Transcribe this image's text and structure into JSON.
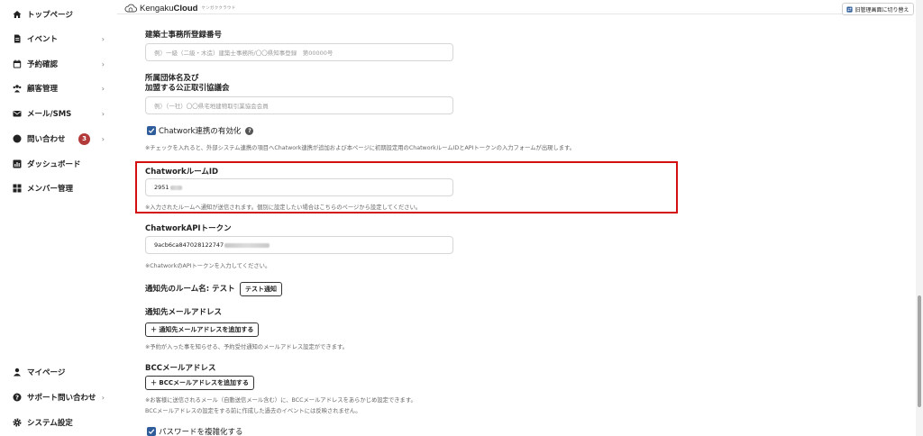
{
  "sidebar": {
    "items": [
      {
        "label": "トップページ",
        "icon": "home-icon"
      },
      {
        "label": "イベント",
        "icon": "document-icon",
        "chevron": "›"
      },
      {
        "label": "予約確認",
        "icon": "calendar-icon",
        "chevron": "›"
      },
      {
        "label": "顧客管理",
        "icon": "users-icon",
        "chevron": "›"
      },
      {
        "label": "メール/SMS",
        "icon": "mail-icon",
        "chevron": "›"
      },
      {
        "label": "問い合わせ",
        "icon": "chat-icon",
        "chevron": "›",
        "badge": "3"
      },
      {
        "label": "ダッシュボード",
        "icon": "chart-icon"
      },
      {
        "label": "メンバー管理",
        "icon": "grid-icon"
      }
    ],
    "bottom_items": [
      {
        "label": "マイページ",
        "icon": "person-icon"
      },
      {
        "label": "サポート問い合わせ",
        "icon": "help-icon",
        "chevron": "›"
      },
      {
        "label": "システム設定",
        "icon": "gear-icon"
      }
    ]
  },
  "header": {
    "logo_prefix": "Kengaku",
    "logo_bold": "Cloud",
    "logo_sub": "ケンガククラウド",
    "switch_button": "旧管理画面に切り替え"
  },
  "form": {
    "registration": {
      "label": "建築士事務所登録番号",
      "placeholder": "例）一級（二級・木造）建築士事務所/〇〇県知事登録　第00000号"
    },
    "association": {
      "label_line1": "所属団体名及び",
      "label_line2": "加盟する公正取引協議会",
      "placeholder": "例）（一社）〇〇県宅地建物取引業協会会員"
    },
    "chatwork_toggle": {
      "label": "Chatwork連携の有効化",
      "checked": true,
      "help": "※チェックを入れると、外部システム連携の項目へChatwork連携が追加および本ページに初期設定用のChatworkルームIDとAPIトークンの入力フォームが出現します。"
    },
    "room_id": {
      "label": "ChatworkルームID",
      "value": "2951",
      "help": "※入力されたルームへ通知が送信されます。個別に設定したい場合はこちらのページから設定してください。"
    },
    "api_token": {
      "label": "ChatworkAPIトークン",
      "value": "9acb6ca847028122747",
      "help": "※ChatworkのAPIトークンを入力してください。"
    },
    "notify_room": {
      "label": "通知先のルーム名: テスト",
      "button": "テスト通知"
    },
    "notify_email": {
      "label": "通知先メールアドレス",
      "button": "＋ 通知先メールアドレスを追加する",
      "help": "※予約が入った事を知らせる、予約受付通知のメールアドレス設定ができます。"
    },
    "bcc_email": {
      "label": "BCCメールアドレス",
      "button": "＋ BCCメールアドレスを追加する",
      "help_line1": "※お客様に送信されるメール（自動送信メール含む）に、BCCメールアドレスをあらかじめ設定できます。",
      "help_line2": "BCCメールアドレスの設定をする前に作成した過去のイベントには反映されません。"
    },
    "password_toggle": {
      "label": "パスワードを複雑化する",
      "checked": true
    }
  },
  "colors": {
    "accent": "#2f5d9c",
    "highlight": "#d40f0f",
    "badge": "#b23a3a"
  }
}
